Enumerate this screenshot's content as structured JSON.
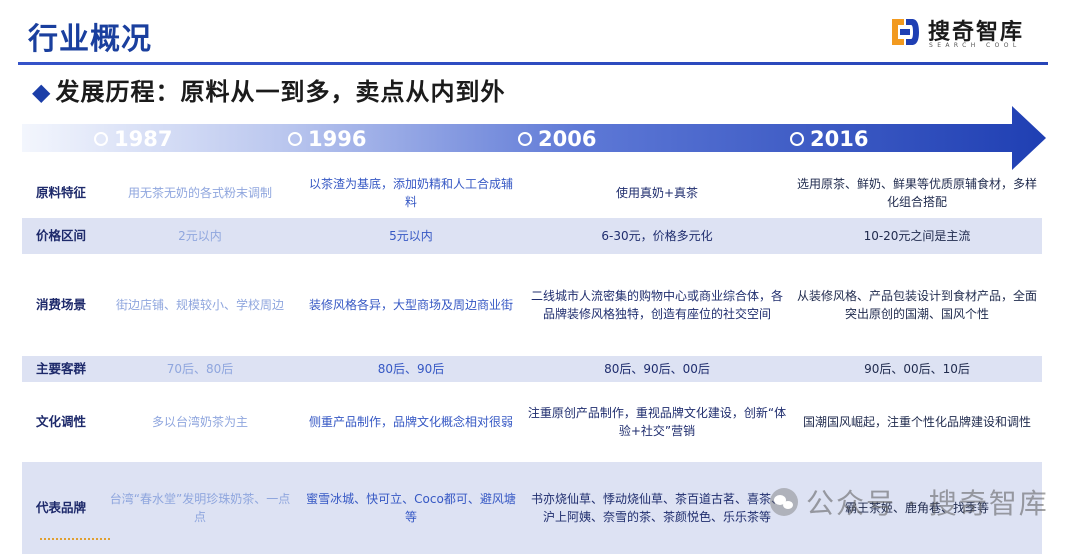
{
  "header": {
    "title": "行业概况",
    "logo_text": "搜奇智库",
    "logo_sub": "SEARCH COOL"
  },
  "subtitle": {
    "bullet": "◆",
    "text": "发展历程：原料从一到多，卖点从内到外"
  },
  "timeline": {
    "years": [
      "1987",
      "1996",
      "2006",
      "2016"
    ]
  },
  "rows": [
    {
      "label": "原料特征",
      "cells": [
        "用无茶无奶的各式粉末调制",
        "以茶渣为基底，添加奶精和人工合成辅料",
        "使用真奶+真茶",
        "选用原茶、鲜奶、鲜果等优质原辅食材，多样化组合搭配"
      ]
    },
    {
      "label": "价格区间",
      "cells": [
        "2元以内",
        "5元以内",
        "6-30元，价格多元化",
        "10-20元之间是主流"
      ]
    },
    {
      "label": "消费场景",
      "cells": [
        "街边店铺、规模较小、学校周边",
        "装修风格各异，大型商场及周边商业街",
        "二线城市人流密集的购物中心或商业综合体，各品牌装修风格独特，创造有座位的社交空间",
        "从装修风格、产品包装设计到食材产品，全面突出原创的国潮、国风个性"
      ]
    },
    {
      "label": "主要客群",
      "cells": [
        "70后、80后",
        "80后、90后",
        "80后、90后、00后",
        "90后、00后、10后"
      ]
    },
    {
      "label": "文化调性",
      "cells": [
        "多以台湾奶茶为主",
        "侧重产品制作，品牌文化概念相对很弱",
        "注重原创产品制作，重视品牌文化建设，创新“体验+社交”营销",
        "国潮国风崛起，注重个性化品牌建设和调性"
      ]
    },
    {
      "label": "代表品牌",
      "cells": [
        "台湾“春水堂”发明珍珠奶茶、一点点",
        "蜜雪冰城、快可立、Coco都可、避风塘等",
        "书亦烧仙草、悸动烧仙草、茶百道古茗、喜茶、沪上阿姨、奈雪的茶、茶颜悦色、乐乐茶等",
        "霸王茶姬、鹿角巷、找季等"
      ]
    }
  ],
  "watermark": {
    "text": "公众号 · 搜奇智库"
  },
  "colors": {
    "brand_blue": "#1a3f9e",
    "arrow_start": "#e9eefb",
    "arrow_end": "#1f3fb3",
    "row_shade": "#dde2f3"
  }
}
